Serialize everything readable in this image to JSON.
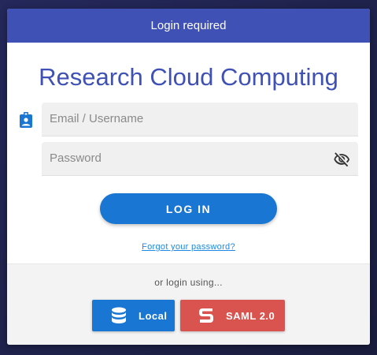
{
  "dialog": {
    "header_title": "Login required",
    "app_title": "Research Cloud Computing"
  },
  "form": {
    "email": {
      "placeholder": "Email / Username",
      "value": "",
      "icon": "contact-badge-icon"
    },
    "password": {
      "placeholder": "Password",
      "value": "",
      "toggle_icon": "eye-off-icon"
    },
    "login_label": "LOG IN",
    "forgot_label": "Forgot your password?"
  },
  "alternatives": {
    "label": "or login using...",
    "local": {
      "label": "Local",
      "icon": "database-icon",
      "color": "#1976d2"
    },
    "saml": {
      "label": "SAML 2.0",
      "icon": "saml-s-icon",
      "color": "#d9534f"
    }
  },
  "colors": {
    "primary": "#3f51b5",
    "button_blue": "#1976d2",
    "link": "#1e88e5"
  }
}
